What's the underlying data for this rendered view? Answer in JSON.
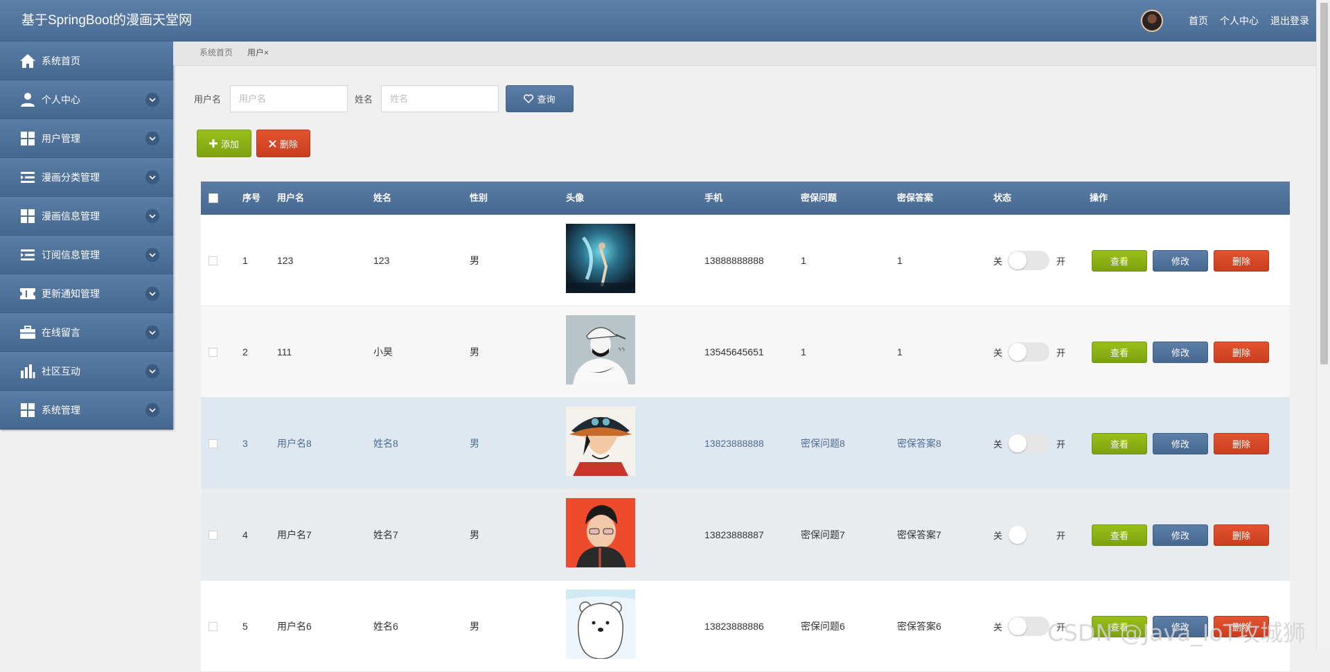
{
  "header": {
    "title": "基于SpringBoot的漫画天堂网",
    "links": [
      "首页",
      "个人中心",
      "退出登录"
    ]
  },
  "sidebar": {
    "items": [
      {
        "label": "系统首页",
        "icon": "home-icon",
        "chevron": false
      },
      {
        "label": "个人中心",
        "icon": "user-icon",
        "chevron": true
      },
      {
        "label": "用户管理",
        "icon": "grid-icon",
        "chevron": true
      },
      {
        "label": "漫画分类管理",
        "icon": "list-icon",
        "chevron": true
      },
      {
        "label": "漫画信息管理",
        "icon": "grid-icon",
        "chevron": true
      },
      {
        "label": "订阅信息管理",
        "icon": "list-icon",
        "chevron": true
      },
      {
        "label": "更新通知管理",
        "icon": "ticket-icon",
        "chevron": true
      },
      {
        "label": "在线留言",
        "icon": "briefcase-icon",
        "chevron": true
      },
      {
        "label": "社区互动",
        "icon": "bar-chart-icon",
        "chevron": true
      },
      {
        "label": "系统管理",
        "icon": "grid-icon",
        "chevron": true
      }
    ]
  },
  "breadcrumb": {
    "home": "系统首页",
    "current": "用户",
    "close": "×"
  },
  "search": {
    "username_label": "用户名",
    "username_placeholder": "用户名",
    "name_label": "姓名",
    "name_placeholder": "姓名",
    "query_button": "查询"
  },
  "actions": {
    "add_button": "添加",
    "delete_button": "删除"
  },
  "table": {
    "columns": [
      "序号",
      "用户名",
      "姓名",
      "性别",
      "头像",
      "手机",
      "密保问题",
      "密保答案",
      "状态",
      "操作"
    ],
    "toggle_off": "关",
    "toggle_on": "开",
    "view_button": "查看",
    "edit_button": "修改",
    "delete_button": "删除",
    "rows": [
      {
        "index": "1",
        "username": "123",
        "name": "123",
        "gender": "男",
        "avatar": "anime-glow-figure",
        "phone": "13888888888",
        "question": "1",
        "answer": "1",
        "enabled": false
      },
      {
        "index": "2",
        "username": "111",
        "name": "小昊",
        "gender": "男",
        "avatar": "cap-guy-sketch",
        "phone": "13545645651",
        "question": "1",
        "answer": "1",
        "enabled": false
      },
      {
        "index": "3",
        "username": "用户名8",
        "name": "姓名8",
        "gender": "男",
        "avatar": "cowboy-hat-anime",
        "phone": "13823888888",
        "question": "密保问题8",
        "answer": "密保答案8",
        "enabled": false
      },
      {
        "index": "4",
        "username": "用户名7",
        "name": "姓名7",
        "gender": "男",
        "avatar": "red-background-anime",
        "phone": "13823888887",
        "question": "密保问题7",
        "answer": "密保答案7",
        "enabled": false
      },
      {
        "index": "5",
        "username": "用户名6",
        "name": "姓名6",
        "gender": "男",
        "avatar": "white-bear-cartoon",
        "phone": "13823888886",
        "question": "密保问题6",
        "answer": "密保答案6",
        "enabled": false
      }
    ]
  },
  "watermark": "CSDN @Java_IoT攻城狮",
  "colors": {
    "primary_blue": "#4a6b93",
    "success_green": "#8db414",
    "danger_red": "#d7472a"
  }
}
